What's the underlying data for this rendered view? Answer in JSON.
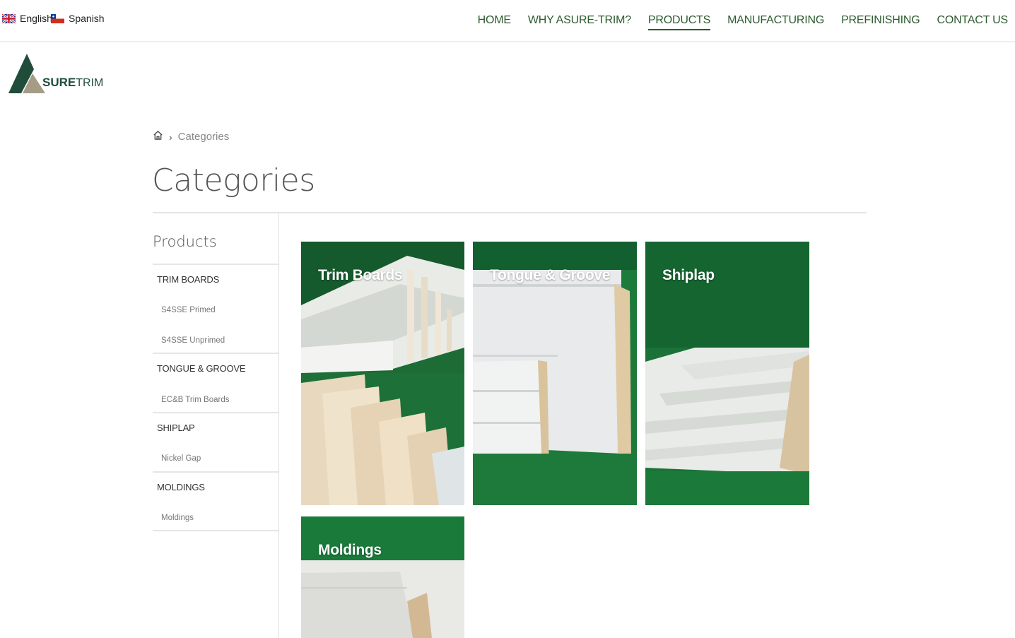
{
  "languages": [
    {
      "label": "English",
      "flag": "uk-flag-icon"
    },
    {
      "label": "Spanish",
      "flag": "chile-flag-icon"
    }
  ],
  "nav": {
    "items": [
      "HOME",
      "WHY ASURE-TRIM?",
      "PRODUCTS",
      "MANUFACTURING",
      "PREFINISHING",
      "CONTACT US"
    ],
    "active": "PRODUCTS"
  },
  "logo": {
    "part1": "SURE",
    "part2": "TRIM"
  },
  "breadcrumb": {
    "home_icon": "home-icon",
    "current": "Categories"
  },
  "page": {
    "title": "Categories"
  },
  "sidebar": {
    "heading": "Products",
    "categories": [
      {
        "label": "TRIM BOARDS",
        "subs": [
          "S4SSE Primed",
          "S4SSE Unprimed"
        ]
      },
      {
        "label": "TONGUE & GROOVE",
        "subs": [
          "EC&B Trim Boards"
        ]
      },
      {
        "label": "SHIPLAP",
        "subs": [
          "Nickel Gap"
        ]
      },
      {
        "label": "MOLDINGS",
        "subs": [
          "Moldings"
        ]
      }
    ]
  },
  "cards": [
    {
      "title": "Trim Boards"
    },
    {
      "title": "Tongue & Groove"
    },
    {
      "title": "Shiplap"
    },
    {
      "title": "Moldings"
    }
  ],
  "colors": {
    "brand_green": "#2d5b2f",
    "backdrop_green": "#1c7a3a",
    "logo_dark": "#1f4d3a",
    "logo_tan": "#a59c86"
  }
}
